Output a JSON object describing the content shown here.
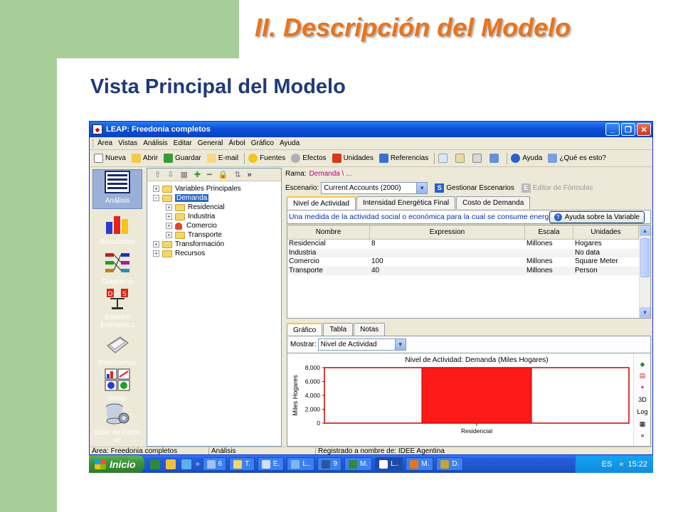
{
  "slide": {
    "title": "II. Descripción del Modelo",
    "subtitle": "Vista Principal del Modelo"
  },
  "window": {
    "title": "LEAP: Freedonia completos",
    "menu": [
      "Área",
      "Vistas",
      "Análisis",
      "Editar",
      "General",
      "Árbol",
      "Gráfico",
      "Ayuda"
    ],
    "toolbar": [
      {
        "label": "Nueva",
        "icon": "new-document-icon",
        "color": "#ffffff"
      },
      {
        "label": "Abrir",
        "icon": "open-folder-icon",
        "color": "#f2c94c"
      },
      {
        "label": "Guardar",
        "icon": "save-icon",
        "color": "#3a9a3a"
      },
      {
        "label": "E-mail",
        "icon": "email-icon",
        "color": "#f5d889"
      },
      {
        "label": "Fuentes",
        "icon": "sources-icon",
        "color": "#f5c518"
      },
      {
        "label": "Efectos",
        "icon": "effects-icon",
        "color": "#b0b0b0"
      },
      {
        "label": "Unidades",
        "icon": "units-icon",
        "color": "#d9361c"
      },
      {
        "label": "Referencias",
        "icon": "references-icon",
        "color": "#3d6fd1"
      }
    ],
    "toolbar_help": "Ayuda",
    "toolbar_whatis": "¿Qué es esto?"
  },
  "nav": [
    {
      "label": "Análisis",
      "icon": "analysis-icon"
    },
    {
      "label": "Resultados",
      "icon": "results-icon"
    },
    {
      "label": "Diagrama",
      "icon": "diagram-icon"
    },
    {
      "label": "Balance Energético",
      "icon": "energy-balance-icon"
    },
    {
      "label": "Resúmenes",
      "icon": "summaries-icon"
    },
    {
      "label": "Vistas",
      "icon": "views-icon"
    },
    {
      "label": "Base de Datos de",
      "icon": "database-icon"
    }
  ],
  "tree": {
    "tools": [
      "⇧",
      "⇩",
      "▦",
      "✚",
      "━",
      "🔒",
      "⇅",
      "»"
    ],
    "nodes": [
      "Variables Principales",
      "Demanda",
      "Residencial",
      "Industria",
      "Comercio",
      "Transporte",
      "Transformación",
      "Recursos"
    ]
  },
  "branch": {
    "label": "Rama:",
    "value": "Demanda \\ ..."
  },
  "scenario": {
    "label": "Escenario:",
    "value": "Current Accounts (2000)",
    "manage": "Gestionar Escenarios",
    "formula_editor": "Editor de Fórmulas"
  },
  "top_tabs": [
    "Nivel de Actividad",
    "Intensidad Energética Final",
    "Costo de Demanda"
  ],
  "description": "Una medida de la actividad social o económica para la cual se consume energía",
  "help_button": "Ayuda sobre la Variable",
  "grid": {
    "headers": [
      "Nombre",
      "Expression",
      "Escala",
      "Unidades"
    ],
    "rows": [
      {
        "name": "Residencial",
        "expression": "8",
        "scale": "Millones",
        "units": "Hogares"
      },
      {
        "name": "Industria",
        "expression": "",
        "scale": "",
        "units": "No data"
      },
      {
        "name": "Comercio",
        "expression": "100",
        "scale": "Millones",
        "units": "Square Meter"
      },
      {
        "name": "Transporte",
        "expression": "40",
        "scale": "Millones",
        "units": "Person"
      }
    ]
  },
  "bottom_tabs": [
    "Gráfico",
    "Tabla",
    "Notas"
  ],
  "show": {
    "label": "Mostrar:",
    "value": "Nivel de Actividad"
  },
  "chart_side_tools": [
    "3D",
    "Log"
  ],
  "chart_data": {
    "type": "bar",
    "title": "Nivel de Actividad: Demanda (Miles Hogares)",
    "categories": [
      "Residencial"
    ],
    "values": [
      8000
    ],
    "ylabel": "Miles Hogares",
    "xlabel": "",
    "ylim": [
      0,
      8000
    ],
    "yticks": [
      "8,000",
      "6,000",
      "4,000",
      "2,000",
      "0"
    ],
    "bar_color": "#ff1a1a",
    "frame_color": "#cc0000"
  },
  "status": [
    "Área: Freedonia completos",
    "Análisis",
    "Registrado a nombre de: IDEE Agentina"
  ],
  "taskbar": {
    "start": "Inicio",
    "tasks": [
      "6",
      "T.",
      "E.",
      "L..",
      "9",
      "M.",
      "L..",
      "M.",
      "D."
    ],
    "lang": "ES",
    "clock": "15:22"
  }
}
